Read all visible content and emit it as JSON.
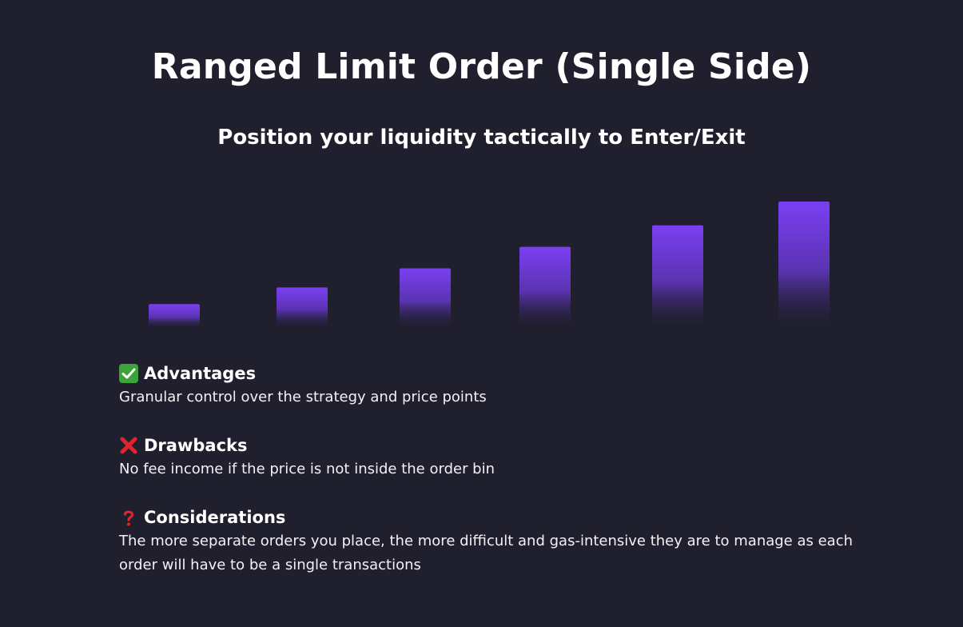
{
  "title": "Ranged Limit Order (Single Side)",
  "subtitle": "Position your liquidity tactically to Enter/Exit",
  "colors": {
    "background": "#1f1f2e",
    "bar_top": "#7b3ff2",
    "bar_fade": "#2a2240",
    "check_green": "#3aa33a",
    "cross_red": "#e0242b"
  },
  "chart_data": {
    "type": "bar",
    "categories": [
      "",
      "",
      "",
      "",
      "",
      ""
    ],
    "values": [
      1,
      1.7,
      2.5,
      3.4,
      4.3,
      5.3
    ],
    "title": "",
    "xlabel": "",
    "ylabel": "",
    "grid": false,
    "legend": "none"
  },
  "sections": [
    {
      "icon": "check-mark-icon",
      "title": "Advantages",
      "body": "Granular control over the strategy and price points"
    },
    {
      "icon": "cross-mark-icon",
      "title": "Drawbacks",
      "body": "No fee income if the price is not inside the order bin"
    },
    {
      "icon": "question-mark-icon",
      "title": "Considerations",
      "body": "The more separate orders you place, the more difficult and gas-intensive they are to manage as each order will have to be a single transactions"
    }
  ]
}
